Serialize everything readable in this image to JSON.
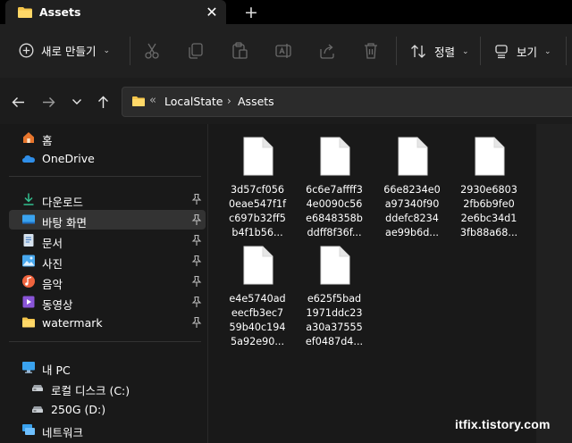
{
  "window": {
    "tab_title": "Assets",
    "close_glyph": "✕",
    "new_tab_glyph": "+"
  },
  "toolbar": {
    "new_label": "새로 만들기",
    "sort_label": "정렬",
    "view_label": "보기",
    "chevron": "⌄"
  },
  "address": {
    "overflow_glyph": "«",
    "crumbs": [
      "LocalState",
      "Assets"
    ],
    "separator": "›"
  },
  "sidebar": {
    "items": [
      {
        "label": "홈",
        "icon": "home-icon"
      },
      {
        "label": "OneDrive",
        "icon": "cloud-icon"
      },
      {
        "label": "다운로드",
        "icon": "download-icon",
        "pinned": true
      },
      {
        "label": "바탕 화면",
        "icon": "desktop-icon",
        "pinned": true,
        "selected": true
      },
      {
        "label": "문서",
        "icon": "document-icon",
        "pinned": true
      },
      {
        "label": "사진",
        "icon": "pictures-icon",
        "pinned": true
      },
      {
        "label": "음악",
        "icon": "music-icon",
        "pinned": true
      },
      {
        "label": "동영상",
        "icon": "video-icon",
        "pinned": true
      },
      {
        "label": "watermark",
        "icon": "folder-icon",
        "pinned": true
      },
      {
        "label": "내 PC",
        "icon": "pc-icon"
      },
      {
        "label": "로컬 디스크 (C:)",
        "icon": "drive-icon"
      },
      {
        "label": "250G (D:)",
        "icon": "drive-icon"
      },
      {
        "label": "네트워크",
        "icon": "network-icon"
      }
    ]
  },
  "files": [
    {
      "lines": [
        "3d57cf056",
        "0eae547f1f",
        "c697b32ff5",
        "b4f1b56..."
      ]
    },
    {
      "lines": [
        "6c6e7affff3",
        "4e0090c56",
        "e6848358b",
        "ddff8f36f..."
      ]
    },
    {
      "lines": [
        "66e8234e0",
        "a97340f90",
        "ddefc8234",
        "ae99b6d..."
      ]
    },
    {
      "lines": [
        "2930e6803",
        "2fb6b9fe0",
        "2e6bc34d1",
        "3fb88a68..."
      ]
    },
    {
      "lines": [
        "e4e5740ad",
        "eecfb3ec7",
        "59b40c194",
        "5a92e90..."
      ]
    },
    {
      "lines": [
        "e625f5bad",
        "1971ddc23",
        "a30a37555",
        "ef0487d4..."
      ]
    }
  ],
  "watermark_text": "itfix.tistory.com",
  "colors": {
    "background": "#191919",
    "toolbar": "#202020",
    "selected": "#333333",
    "folder": "#f4c54a",
    "accent_blue": "#4aa3f0"
  }
}
